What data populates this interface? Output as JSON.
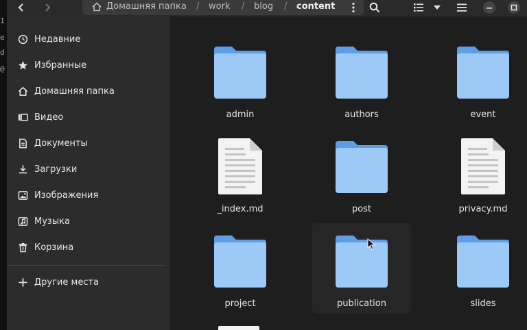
{
  "terminal_peek": [
    "1",
    "e",
    "d",
    "@"
  ],
  "colors": {
    "folder_body": "#9cc9f5",
    "folder_tab": "#5c9de6",
    "accent": "#3584e4"
  },
  "header": {
    "icons": [
      "back-icon",
      "forward-icon",
      "home-icon",
      "kebab-menu-icon",
      "search-icon",
      "list-view-icon",
      "chevron-down-icon",
      "hamburger-menu-icon",
      "minimize-icon",
      "maximize-icon"
    ],
    "breadcrumb": [
      {
        "label": "Домашняя папка"
      },
      {
        "label": "work"
      },
      {
        "label": "blog"
      },
      {
        "label": "content"
      }
    ],
    "separator": "/"
  },
  "sidebar": {
    "items": [
      {
        "label": "Недавние",
        "icon": "recent-icon"
      },
      {
        "label": "Избранные",
        "icon": "star-icon"
      },
      {
        "label": "Домашняя папка",
        "icon": "home-icon"
      },
      {
        "label": "Видео",
        "icon": "video-icon"
      },
      {
        "label": "Документы",
        "icon": "documents-icon"
      },
      {
        "label": "Загрузки",
        "icon": "downloads-icon"
      },
      {
        "label": "Изображения",
        "icon": "images-icon"
      },
      {
        "label": "Музыка",
        "icon": "music-icon"
      },
      {
        "label": "Корзина",
        "icon": "trash-icon"
      }
    ],
    "other_places": {
      "label": "Другие места",
      "icon": "plus-icon"
    }
  },
  "files": [
    {
      "name": "admin",
      "type": "folder"
    },
    {
      "name": "authors",
      "type": "folder"
    },
    {
      "name": "event",
      "type": "folder"
    },
    {
      "name": "_index.md",
      "type": "file"
    },
    {
      "name": "post",
      "type": "folder"
    },
    {
      "name": "privacy.md",
      "type": "file"
    },
    {
      "name": "project",
      "type": "folder"
    },
    {
      "name": "publication",
      "type": "folder",
      "hovered": true
    },
    {
      "name": "slides",
      "type": "folder"
    }
  ]
}
